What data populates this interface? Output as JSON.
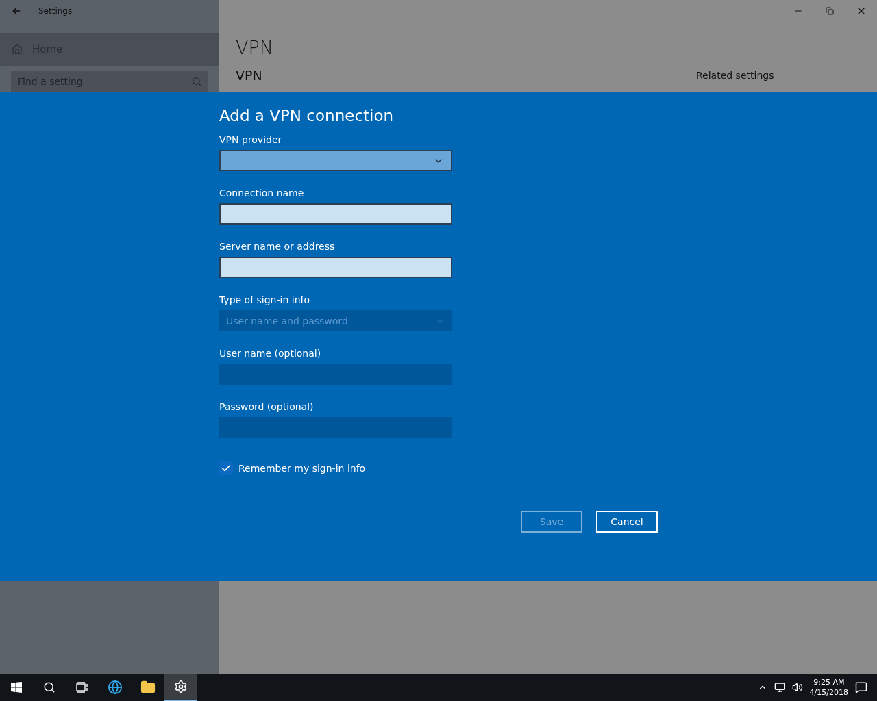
{
  "window": {
    "title": "Settings"
  },
  "sidebar": {
    "home": "Home",
    "search": {
      "placeholder": "Find a setting"
    }
  },
  "page": {
    "title": "VPN",
    "section": "VPN",
    "related_title": "Related settings"
  },
  "dialog": {
    "title": "Add a VPN connection",
    "fields": [
      {
        "label": "VPN provider",
        "kind": "dropdown",
        "disabled": false
      },
      {
        "label": "Connection name",
        "kind": "text",
        "disabled": false
      },
      {
        "label": "Server name or address",
        "kind": "text",
        "disabled": false
      },
      {
        "label": "Type of sign-in info",
        "kind": "dropdown",
        "disabled": true,
        "value": "User name and password"
      },
      {
        "label": "User name (optional)",
        "kind": "text",
        "disabled": true
      },
      {
        "label": "Password (optional)",
        "kind": "text",
        "disabled": true
      }
    ],
    "remember": {
      "label": "Remember my sign-in info",
      "checked": true
    },
    "buttons": [
      {
        "label": "Save",
        "disabled": true
      },
      {
        "label": "Cancel",
        "disabled": false
      }
    ]
  },
  "taskbar": {
    "apps": [
      {
        "kind": "start",
        "selected": false
      },
      {
        "kind": "search",
        "selected": false
      },
      {
        "kind": "taskview",
        "selected": false
      },
      {
        "kind": "browser",
        "selected": false
      },
      {
        "kind": "folder",
        "selected": false
      },
      {
        "kind": "settings",
        "selected": true
      }
    ],
    "time": "9:25 AM",
    "date": "4/15/2018"
  }
}
